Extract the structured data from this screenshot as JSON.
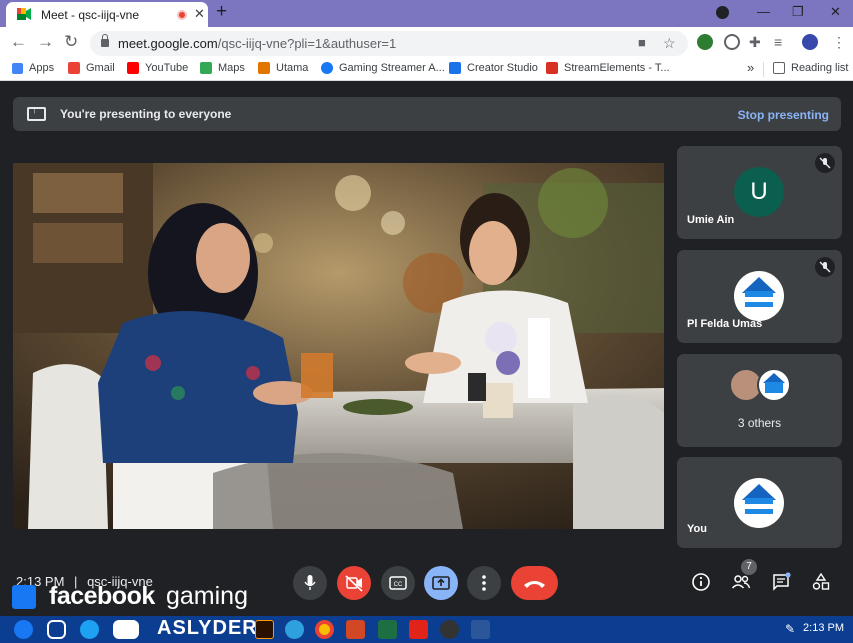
{
  "browser": {
    "tab_title": "Meet - qsc-iijq-vne",
    "new_tab_symbol": "+",
    "url_host": "meet.google.com",
    "url_path": "/qsc-iijq-vne?pli=1&authuser=1"
  },
  "bookmarks": [
    {
      "label": "Apps",
      "icon": "apps-grid-icon",
      "color": "#4285f4"
    },
    {
      "label": "Gmail",
      "icon": "gmail-icon",
      "color": "#ea4335"
    },
    {
      "label": "YouTube",
      "icon": "youtube-icon",
      "color": "#ff0000"
    },
    {
      "label": "Maps",
      "icon": "maps-icon",
      "color": "#34a853"
    },
    {
      "label": "Utama",
      "icon": "utama-icon",
      "color": "#e37400"
    },
    {
      "label": "Gaming Streamer A...",
      "icon": "facebook-icon",
      "color": "#1877f2"
    },
    {
      "label": "Creator Studio",
      "icon": "creator-studio-icon",
      "color": "#1a73e8"
    },
    {
      "label": "StreamElements - T...",
      "icon": "streamelements-icon",
      "color": "#d93025"
    }
  ],
  "bookmarks_more": "»",
  "reading_list": "Reading list",
  "meet": {
    "banner_text": "You're presenting to everyone",
    "stop_presenting": "Stop presenting",
    "participants": [
      {
        "name": "Umie Ain",
        "initial": "U",
        "muted": true
      },
      {
        "name": "Pl Felda Umas",
        "muted": true
      },
      {
        "name": "3 others"
      },
      {
        "name": "You"
      }
    ],
    "meeting_time": "2:13 PM",
    "separator": "|",
    "meeting_code": "qsc-iijq-vne",
    "people_count": "7"
  },
  "overlay": {
    "facebook": "facebook",
    "gaming": "gaming",
    "handle": "ASLYDER"
  },
  "taskbar": {
    "clock": "2:13 PM"
  },
  "colors": {
    "meet_bg": "#202124",
    "tile_bg": "#3c4043",
    "accent": "#8ab4f8",
    "danger": "#ea4335"
  }
}
